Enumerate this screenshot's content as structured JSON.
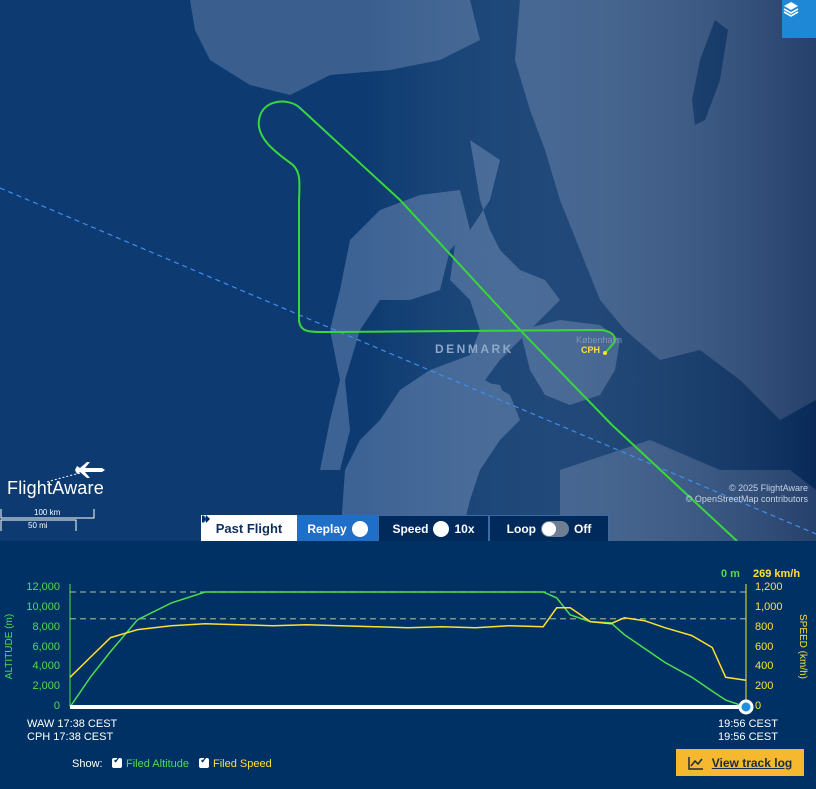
{
  "map": {
    "country_label": "DENMARK",
    "city_label": "København",
    "airport_label": "CPH",
    "copyright_1": "© 2025 FlightAware",
    "copyright_2": "© OpenStreetMap contributors",
    "logo_text": "FlightAware",
    "scale_km": "100 km",
    "scale_mi": "50 mi",
    "icon_layers": "layers-icon",
    "route_color": "#39d63b",
    "great_circle_color": "#3d8ef2"
  },
  "controls": {
    "past_flight": "Past Flight",
    "replay": "Replay",
    "speed_label": "Speed",
    "speed_value": "10x",
    "loop_label": "Loop",
    "loop_value": "Off"
  },
  "chart": {
    "current_altitude": "0 m",
    "current_speed": "269 km/h",
    "left_axis_label": "ALTITUDE (m)",
    "right_axis_label": "SPEED (km/h)",
    "left_ticks": [
      "12,000",
      "10,000",
      "8,000",
      "6,000",
      "4,000",
      "2,000",
      "0"
    ],
    "right_ticks": [
      "1,200",
      "1,000",
      "800",
      "600",
      "400",
      "200",
      "0"
    ],
    "departure_line_1": "WAW 17:38 CEST",
    "departure_line_2": "CPH 17:38 CEST",
    "arrival_line_1": "19:56 CEST",
    "arrival_line_2": "19:56 CEST"
  },
  "footer": {
    "show_label": "Show:",
    "filed_altitude": "Filed Altitude",
    "filed_speed": "Filed Speed",
    "view_track_log": "View track log"
  },
  "chart_data": {
    "type": "line",
    "xlabel": "",
    "ylabel": "ALTITUDE (m)",
    "y2label": "SPEED (km/h)",
    "ylim": [
      0,
      12000
    ],
    "y2lim": [
      0,
      1200
    ],
    "x": [
      0,
      0.03,
      0.06,
      0.1,
      0.15,
      0.2,
      0.25,
      0.3,
      0.35,
      0.4,
      0.45,
      0.5,
      0.55,
      0.6,
      0.65,
      0.7,
      0.72,
      0.74,
      0.77,
      0.8,
      0.82,
      0.85,
      0.88,
      0.92,
      0.95,
      0.97,
      1.0
    ],
    "series": [
      {
        "name": "Filed Altitude",
        "color": "#4dde4f",
        "axis": "left",
        "values": [
          0,
          3000,
          5600,
          8800,
          10500,
          11600,
          11600,
          11600,
          11600,
          11600,
          11600,
          11600,
          11600,
          11600,
          11600,
          11600,
          11000,
          9300,
          8600,
          8500,
          7300,
          5900,
          4500,
          3000,
          1600,
          700,
          0
        ]
      },
      {
        "name": "Filed Speed",
        "color": "#ffe033",
        "axis": "right",
        "values": [
          300,
          500,
          700,
          780,
          820,
          840,
          830,
          820,
          830,
          820,
          810,
          800,
          810,
          800,
          820,
          810,
          1000,
          1000,
          860,
          840,
          900,
          870,
          800,
          720,
          600,
          300,
          269
        ]
      }
    ],
    "reference_lines": [
      11600,
      8900
    ]
  }
}
